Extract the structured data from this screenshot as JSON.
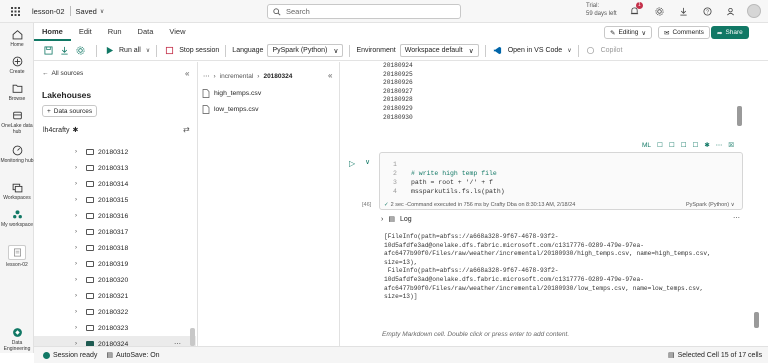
{
  "topbar": {
    "workspace": "lesson-02",
    "saved": "Saved",
    "search_placeholder": "Search",
    "trial_line1": "Trial:",
    "trial_line2": "59 days left",
    "notif_count": "1"
  },
  "nav": [
    {
      "label": "Home"
    },
    {
      "label": "Create"
    },
    {
      "label": "Browse"
    },
    {
      "label": "OneLake data hub"
    },
    {
      "label": "Monitoring hub"
    },
    {
      "label": "Workspaces"
    },
    {
      "label": "My workspace"
    },
    {
      "label": "lesson-02"
    },
    {
      "label": "Data Engineering"
    }
  ],
  "tabs": [
    "Home",
    "Edit",
    "Run",
    "Data",
    "View"
  ],
  "ribbon": {
    "editing": "Editing",
    "comments": "Comments",
    "share": "Share",
    "run_all": "Run all",
    "stop_session": "Stop session",
    "language_label": "Language",
    "language_value": "PySpark (Python)",
    "environment_label": "Environment",
    "environment_value": "Workspace default",
    "open_vscode": "Open in VS Code",
    "copilot": "Copilot"
  },
  "explorer": {
    "all_sources": "All sources",
    "lakehouses": "Lakehouses",
    "data_sources": "Data sources",
    "lakehouse_name": "lh4crafty",
    "folders": [
      "20180312",
      "20180313",
      "20180314",
      "20180315",
      "20180316",
      "20180317",
      "20180318",
      "20180319",
      "20180320",
      "20180321",
      "20180322",
      "20180323",
      "20180324"
    ]
  },
  "filepane": {
    "crumb1": "incremental",
    "crumb2": "20180324",
    "files": [
      "high_temps.csv",
      "low_temps.csv"
    ]
  },
  "notebook": {
    "prev_output": [
      "20180924",
      "20180925",
      "20180926",
      "20180927",
      "20180928",
      "20180929",
      "20180930"
    ],
    "cell_toolbar": [
      "ML",
      "☐",
      "☐",
      "☐",
      "☐",
      "✱",
      "⋯",
      "☒"
    ],
    "code": [
      {
        "ln": "1",
        "text": ""
      },
      {
        "ln": "2",
        "text": "# write high temp file"
      },
      {
        "ln": "3",
        "text": "path = root + '/' + f"
      },
      {
        "ln": "4",
        "text": "mssparkutils.fs.ls(path)"
      }
    ],
    "cell_number": "[46]",
    "exec_info": "2 sec -Command executed in 756 ms by Crafty Dba on 8:30:13 AM, 2/18/24",
    "cell_lang": "PySpark (Python)",
    "log_label": "Log",
    "output": "[FileInfo(path=abfss://a668a328-9f67-4678-93f2-\n10d5afdfe3ad@onelake.dfs.fabric.microsoft.com/c1317776-0289-479e-97ea-\nafc6477b90f0/Files/raw/weather/incremental/20180930/high_temps.csv, name=high_temps.csv,\nsize=13),\n FileInfo(path=abfss://a668a328-9f67-4678-93f2-\n10d5afdfe3ad@onelake.dfs.fabric.microsoft.com/c1317776-0289-479e-97ea-\nafc6477b90f0/Files/raw/weather/incremental/20180930/low_temps.csv, name=low_temps.csv,\nsize=13)]",
    "md_placeholder": "Empty Markdown cell. Double click or press enter to add content."
  },
  "status": {
    "ready": "Session ready",
    "autosave": "AutoSave: On",
    "cell_sel": "Selected Cell 15 of 17 cells"
  },
  "colors": {
    "accent": "#117865",
    "brand_dark": "#1f5b52"
  }
}
